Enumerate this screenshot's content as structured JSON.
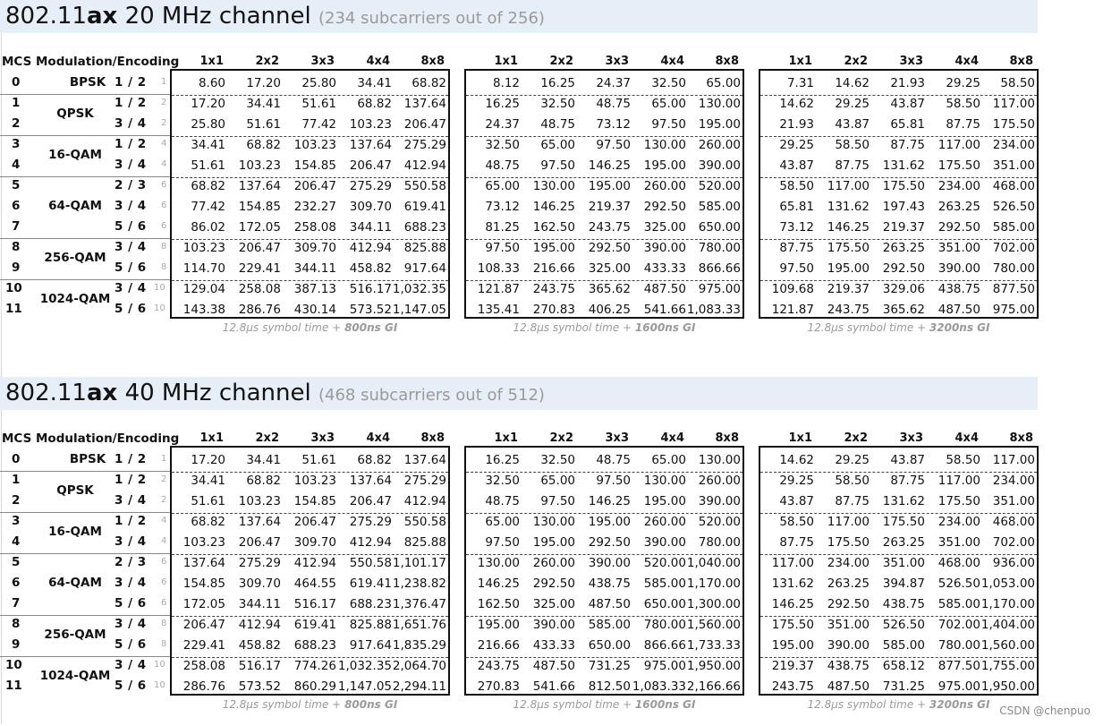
{
  "sections": [
    {
      "title_pre": "802.11",
      "title_bold": "ax",
      "title_post": " 20 MHz channel",
      "subtitle": "(234 subcarriers out of 256)",
      "captions": [
        {
          "pre": "12.8μs symbol time + ",
          "bold": "800ns GI"
        },
        {
          "pre": "12.8μs symbol time + ",
          "bold": "1600ns GI"
        },
        {
          "pre": "12.8μs symbol time + ",
          "bold": "3200ns GI"
        }
      ],
      "tables": [
        [
          [
            "8.60",
            "17.20",
            "25.80",
            "34.41",
            "68.82"
          ],
          [
            "17.20",
            "34.41",
            "51.61",
            "68.82",
            "137.64"
          ],
          [
            "25.80",
            "51.61",
            "77.42",
            "103.23",
            "206.47"
          ],
          [
            "34.41",
            "68.82",
            "103.23",
            "137.64",
            "275.29"
          ],
          [
            "51.61",
            "103.23",
            "154.85",
            "206.47",
            "412.94"
          ],
          [
            "68.82",
            "137.64",
            "206.47",
            "275.29",
            "550.58"
          ],
          [
            "77.42",
            "154.85",
            "232.27",
            "309.70",
            "619.41"
          ],
          [
            "86.02",
            "172.05",
            "258.08",
            "344.11",
            "688.23"
          ],
          [
            "103.23",
            "206.47",
            "309.70",
            "412.94",
            "825.88"
          ],
          [
            "114.70",
            "229.41",
            "344.11",
            "458.82",
            "917.64"
          ],
          [
            "129.04",
            "258.08",
            "387.13",
            "516.17",
            "1,032.35"
          ],
          [
            "143.38",
            "286.76",
            "430.14",
            "573.52",
            "1,147.05"
          ]
        ],
        [
          [
            "8.12",
            "16.25",
            "24.37",
            "32.50",
            "65.00"
          ],
          [
            "16.25",
            "32.50",
            "48.75",
            "65.00",
            "130.00"
          ],
          [
            "24.37",
            "48.75",
            "73.12",
            "97.50",
            "195.00"
          ],
          [
            "32.50",
            "65.00",
            "97.50",
            "130.00",
            "260.00"
          ],
          [
            "48.75",
            "97.50",
            "146.25",
            "195.00",
            "390.00"
          ],
          [
            "65.00",
            "130.00",
            "195.00",
            "260.00",
            "520.00"
          ],
          [
            "73.12",
            "146.25",
            "219.37",
            "292.50",
            "585.00"
          ],
          [
            "81.25",
            "162.50",
            "243.75",
            "325.00",
            "650.00"
          ],
          [
            "97.50",
            "195.00",
            "292.50",
            "390.00",
            "780.00"
          ],
          [
            "108.33",
            "216.66",
            "325.00",
            "433.33",
            "866.66"
          ],
          [
            "121.87",
            "243.75",
            "365.62",
            "487.50",
            "975.00"
          ],
          [
            "135.41",
            "270.83",
            "406.25",
            "541.66",
            "1,083.33"
          ]
        ],
        [
          [
            "7.31",
            "14.62",
            "21.93",
            "29.25",
            "58.50"
          ],
          [
            "14.62",
            "29.25",
            "43.87",
            "58.50",
            "117.00"
          ],
          [
            "21.93",
            "43.87",
            "65.81",
            "87.75",
            "175.50"
          ],
          [
            "29.25",
            "58.50",
            "87.75",
            "117.00",
            "234.00"
          ],
          [
            "43.87",
            "87.75",
            "131.62",
            "175.50",
            "351.00"
          ],
          [
            "58.50",
            "117.00",
            "175.50",
            "234.00",
            "468.00"
          ],
          [
            "65.81",
            "131.62",
            "197.43",
            "263.25",
            "526.50"
          ],
          [
            "73.12",
            "146.25",
            "219.37",
            "292.50",
            "585.00"
          ],
          [
            "87.75",
            "175.50",
            "263.25",
            "351.00",
            "702.00"
          ],
          [
            "97.50",
            "195.00",
            "292.50",
            "390.00",
            "780.00"
          ],
          [
            "109.68",
            "219.37",
            "329.06",
            "438.75",
            "877.50"
          ],
          [
            "121.87",
            "243.75",
            "365.62",
            "487.50",
            "975.00"
          ]
        ]
      ]
    },
    {
      "title_pre": "802.11",
      "title_bold": "ax",
      "title_post": " 40 MHz channel",
      "subtitle": "(468 subcarriers out of 512)",
      "captions": [
        {
          "pre": "12.8μs symbol time + ",
          "bold": "800ns GI"
        },
        {
          "pre": "12.8μs symbol time + ",
          "bold": "1600ns GI"
        },
        {
          "pre": "12.8μs symbol time + ",
          "bold": "3200ns GI"
        }
      ],
      "tables": [
        [
          [
            "17.20",
            "34.41",
            "51.61",
            "68.82",
            "137.64"
          ],
          [
            "34.41",
            "68.82",
            "103.23",
            "137.64",
            "275.29"
          ],
          [
            "51.61",
            "103.23",
            "154.85",
            "206.47",
            "412.94"
          ],
          [
            "68.82",
            "137.64",
            "206.47",
            "275.29",
            "550.58"
          ],
          [
            "103.23",
            "206.47",
            "309.70",
            "412.94",
            "825.88"
          ],
          [
            "137.64",
            "275.29",
            "412.94",
            "550.58",
            "1,101.17"
          ],
          [
            "154.85",
            "309.70",
            "464.55",
            "619.41",
            "1,238.82"
          ],
          [
            "172.05",
            "344.11",
            "516.17",
            "688.23",
            "1,376.47"
          ],
          [
            "206.47",
            "412.94",
            "619.41",
            "825.88",
            "1,651.76"
          ],
          [
            "229.41",
            "458.82",
            "688.23",
            "917.64",
            "1,835.29"
          ],
          [
            "258.08",
            "516.17",
            "774.26",
            "1,032.35",
            "2,064.70"
          ],
          [
            "286.76",
            "573.52",
            "860.29",
            "1,147.05",
            "2,294.11"
          ]
        ],
        [
          [
            "16.25",
            "32.50",
            "48.75",
            "65.00",
            "130.00"
          ],
          [
            "32.50",
            "65.00",
            "97.50",
            "130.00",
            "260.00"
          ],
          [
            "48.75",
            "97.50",
            "146.25",
            "195.00",
            "390.00"
          ],
          [
            "65.00",
            "130.00",
            "195.00",
            "260.00",
            "520.00"
          ],
          [
            "97.50",
            "195.00",
            "292.50",
            "390.00",
            "780.00"
          ],
          [
            "130.00",
            "260.00",
            "390.00",
            "520.00",
            "1,040.00"
          ],
          [
            "146.25",
            "292.50",
            "438.75",
            "585.00",
            "1,170.00"
          ],
          [
            "162.50",
            "325.00",
            "487.50",
            "650.00",
            "1,300.00"
          ],
          [
            "195.00",
            "390.00",
            "585.00",
            "780.00",
            "1,560.00"
          ],
          [
            "216.66",
            "433.33",
            "650.00",
            "866.66",
            "1,733.33"
          ],
          [
            "243.75",
            "487.50",
            "731.25",
            "975.00",
            "1,950.00"
          ],
          [
            "270.83",
            "541.66",
            "812.50",
            "1,083.33",
            "2,166.66"
          ]
        ],
        [
          [
            "14.62",
            "29.25",
            "43.87",
            "58.50",
            "117.00"
          ],
          [
            "29.25",
            "58.50",
            "87.75",
            "117.00",
            "234.00"
          ],
          [
            "43.87",
            "87.75",
            "131.62",
            "175.50",
            "351.00"
          ],
          [
            "58.50",
            "117.00",
            "175.50",
            "234.00",
            "468.00"
          ],
          [
            "87.75",
            "175.50",
            "263.25",
            "351.00",
            "702.00"
          ],
          [
            "117.00",
            "234.00",
            "351.00",
            "468.00",
            "936.00"
          ],
          [
            "131.62",
            "263.25",
            "394.87",
            "526.50",
            "1,053.00"
          ],
          [
            "146.25",
            "292.50",
            "438.75",
            "585.00",
            "1,170.00"
          ],
          [
            "175.50",
            "351.00",
            "526.50",
            "702.00",
            "1,404.00"
          ],
          [
            "195.00",
            "390.00",
            "585.00",
            "780.00",
            "1,560.00"
          ],
          [
            "219.37",
            "438.75",
            "658.12",
            "877.50",
            "1,755.00"
          ],
          [
            "243.75",
            "487.50",
            "731.25",
            "975.00",
            "1,950.00"
          ]
        ]
      ]
    }
  ],
  "header_labels": {
    "mcs": "MCS",
    "modulation": "Modulation/Encoding"
  },
  "stream_columns": [
    "1x1",
    "2x2",
    "3x3",
    "4x4",
    "8x8"
  ],
  "mcs_rows": [
    {
      "mcs": "0",
      "rate": "1 / 2",
      "small": "1"
    },
    {
      "mcs": "1",
      "rate": "1 / 2",
      "small": "2"
    },
    {
      "mcs": "2",
      "rate": "3 / 4",
      "small": "2"
    },
    {
      "mcs": "3",
      "rate": "1 / 2",
      "small": "4"
    },
    {
      "mcs": "4",
      "rate": "3 / 4",
      "small": "4"
    },
    {
      "mcs": "5",
      "rate": "2 / 3",
      "small": "6"
    },
    {
      "mcs": "6",
      "rate": "3 / 4",
      "small": "6"
    },
    {
      "mcs": "7",
      "rate": "5 / 6",
      "small": "6"
    },
    {
      "mcs": "8",
      "rate": "3 / 4",
      "small": "8"
    },
    {
      "mcs": "9",
      "rate": "5 / 6",
      "small": "8"
    },
    {
      "mcs": "10",
      "rate": "3 / 4",
      "small": "10"
    },
    {
      "mcs": "11",
      "rate": "5 / 6",
      "small": "10"
    }
  ],
  "modulations": [
    "BPSK",
    "QPSK",
    "16-QAM",
    "64-QAM",
    "256-QAM",
    "1024-QAM"
  ],
  "watermark": "CSDN @chenpuo"
}
